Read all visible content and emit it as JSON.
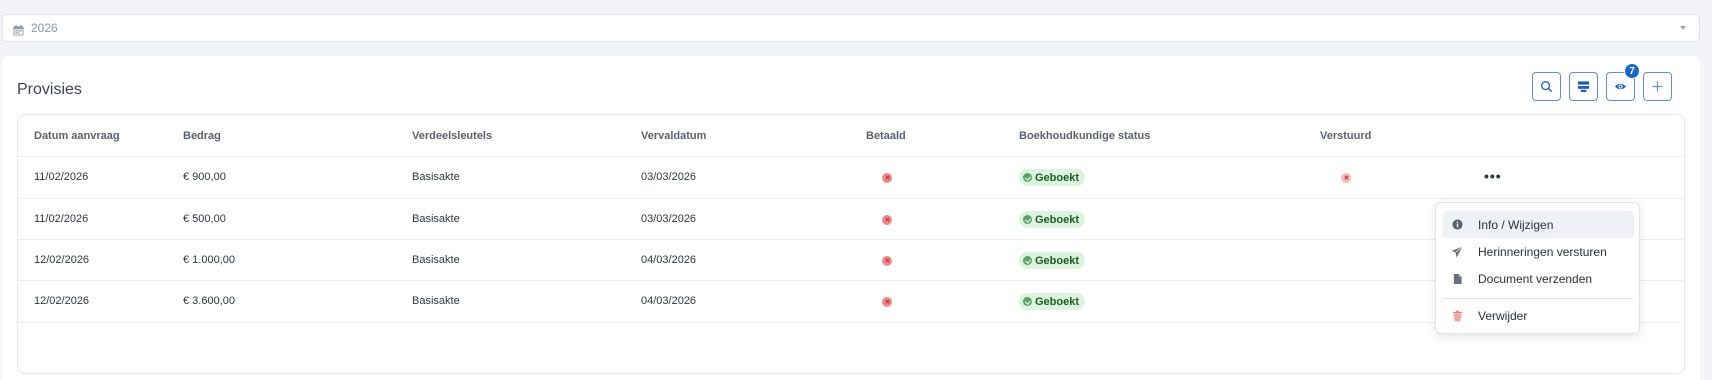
{
  "year_filter": {
    "value": "2026",
    "icon": "calendar-icon"
  },
  "card": {
    "title": "Provisies",
    "toolbar": {
      "search": "search-icon",
      "layout": "table-layout-icon",
      "columns": "eye-icon",
      "columns_badge": "7",
      "add": "plus-icon"
    }
  },
  "table": {
    "headers": [
      "Datum aanvraag",
      "Bedrag",
      "Verdeelsleutels",
      "Vervaldatum",
      "Betaald",
      "Boekhoudkundige status",
      "Verstuurd"
    ],
    "rows": [
      {
        "datum": "11/02/2026",
        "bedrag": "€ 900,00",
        "verdeel": "Basisakte",
        "verval": "03/03/2026",
        "betaald": false,
        "status": "Geboekt",
        "verstuurd": false
      },
      {
        "datum": "11/02/2026",
        "bedrag": "€ 500,00",
        "verdeel": "Basisakte",
        "verval": "03/03/2026",
        "betaald": false,
        "status": "Geboekt",
        "verstuurd": false
      },
      {
        "datum": "12/02/2026",
        "bedrag": "€ 1.000,00",
        "verdeel": "Basisakte",
        "verval": "04/03/2026",
        "betaald": false,
        "status": "Geboekt",
        "verstuurd": false
      },
      {
        "datum": "12/02/2026",
        "bedrag": "€ 3.600,00",
        "verdeel": "Basisakte",
        "verval": "04/03/2026",
        "betaald": false,
        "status": "Geboekt",
        "verstuurd": false
      }
    ]
  },
  "context_menu": {
    "items": [
      {
        "label": "Info / Wijzigen",
        "icon": "info-icon"
      },
      {
        "label": "Herinneringen versturen",
        "icon": "send-icon"
      },
      {
        "label": "Document verzenden",
        "icon": "document-icon"
      },
      {
        "label": "Verwijder",
        "icon": "trash-icon"
      }
    ]
  },
  "colors": {
    "accent": "#1667c9",
    "danger": "#f08a8a",
    "success_bg": "#dcf3de",
    "success_text": "#1f5d27"
  }
}
